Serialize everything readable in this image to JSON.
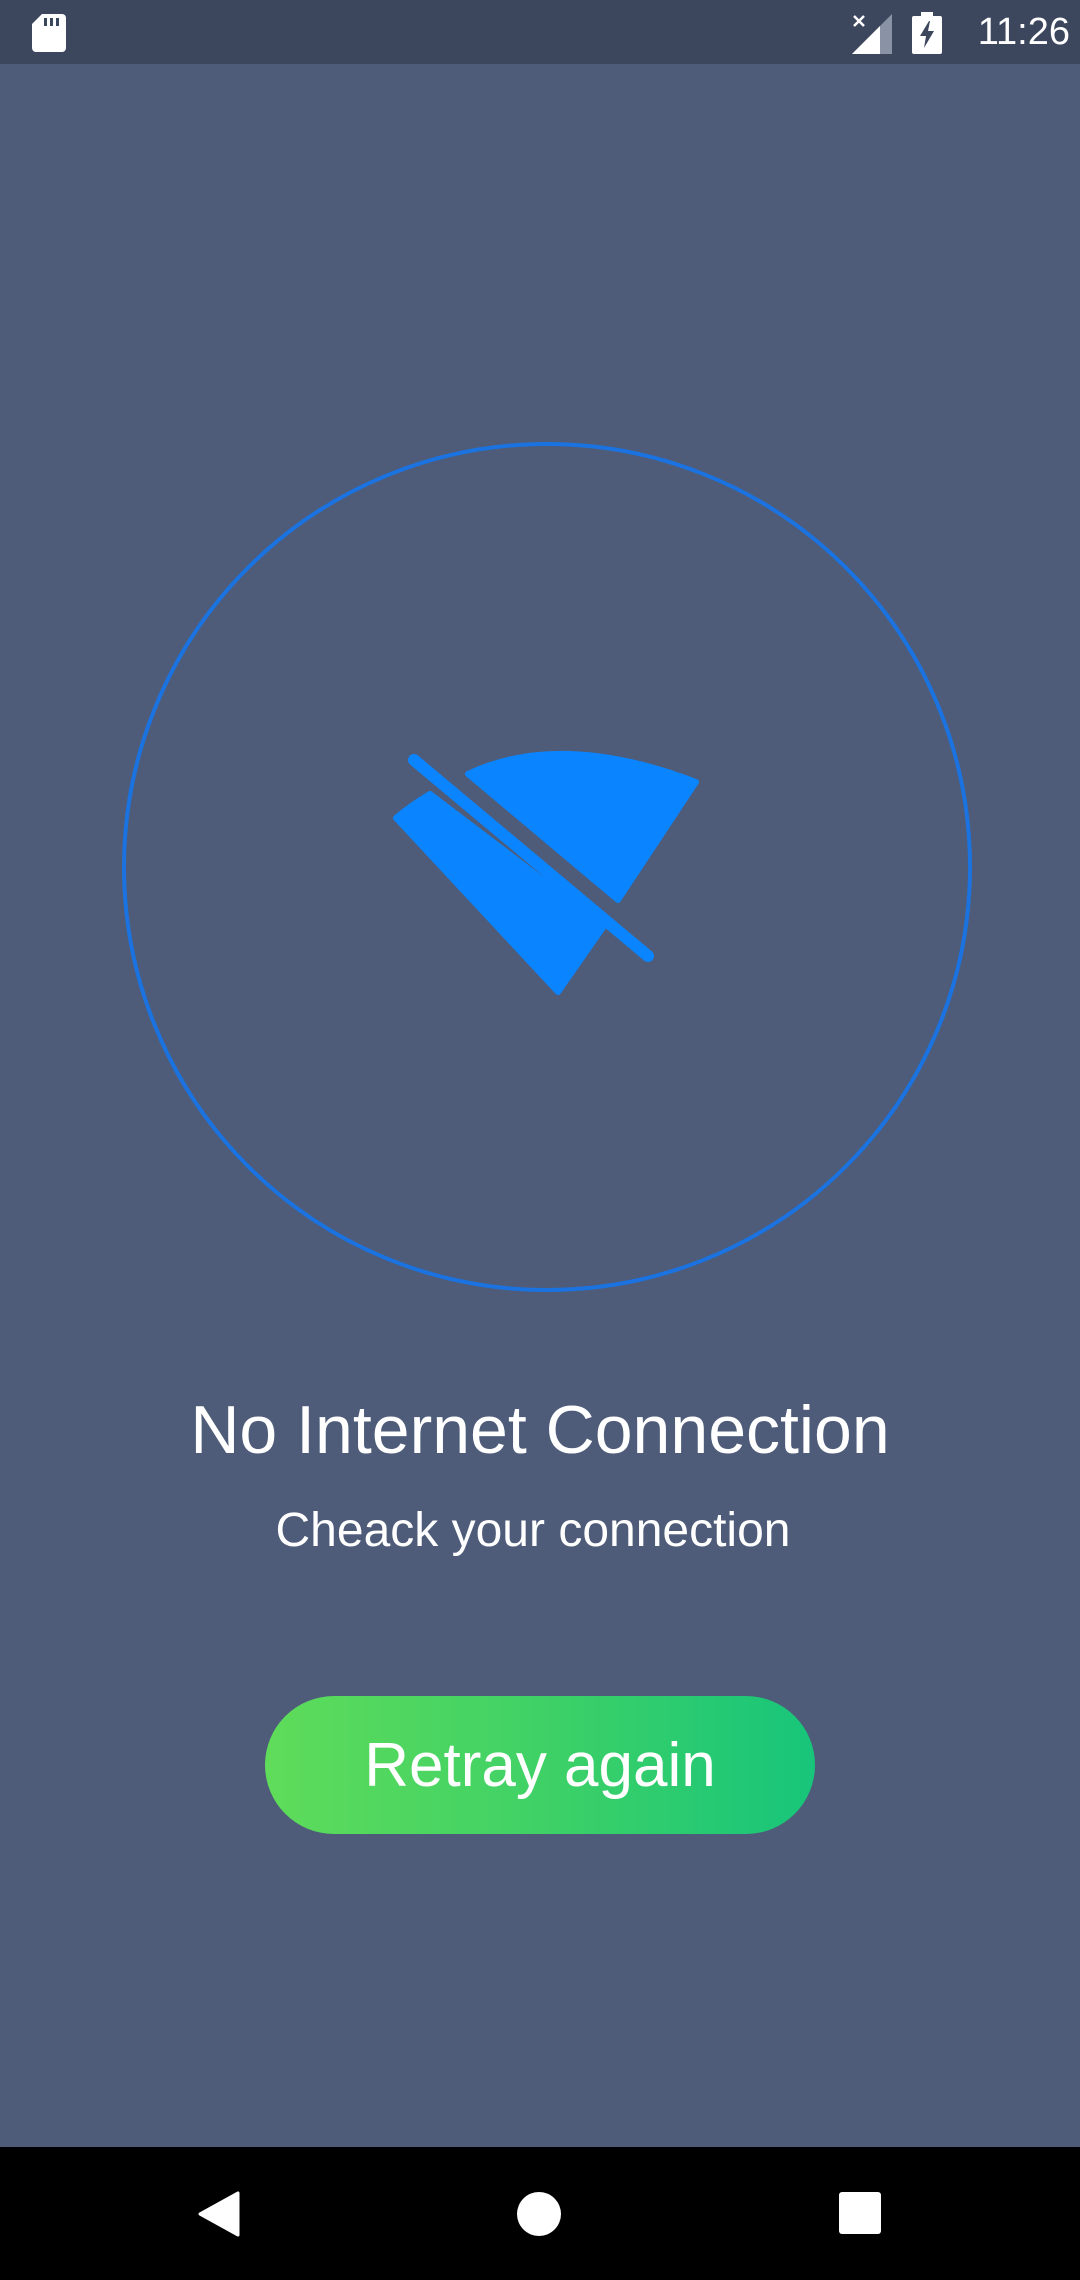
{
  "status_bar": {
    "time": "11:26",
    "icons": [
      "sd-card-icon",
      "signal-no-service-icon",
      "battery-charging-icon"
    ]
  },
  "main": {
    "icon": "wifi-off-icon",
    "title": "No Internet Connection",
    "subtitle": "Cheack your connection",
    "retry_label": "Retray again"
  },
  "nav_bar": {
    "icons": [
      "back-icon",
      "home-icon",
      "recents-icon"
    ]
  },
  "colors": {
    "background": "#4e5c79",
    "status_bar": "#3c465d",
    "accent_blue": "#0a84ff",
    "ring_blue": "#1a73e0",
    "button_gradient_start": "#5fdc5a",
    "button_gradient_end": "#17c57a"
  }
}
